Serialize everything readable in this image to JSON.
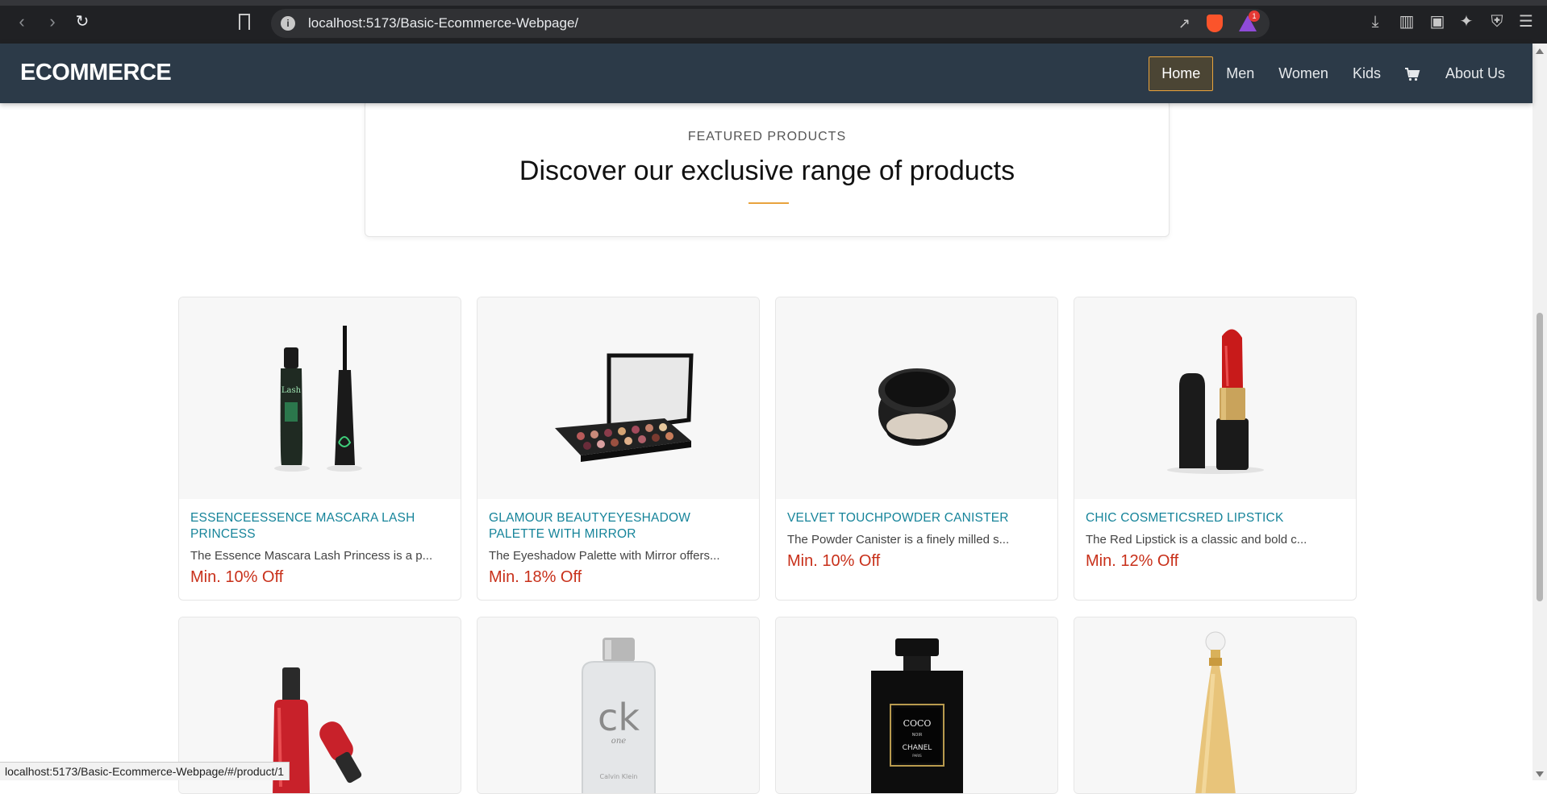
{
  "browser": {
    "url": "localhost:5173/Basic-Ecommerce-Webpage/",
    "notification_count": "1",
    "status_url": "localhost:5173/Basic-Ecommerce-Webpage/#/product/1"
  },
  "site": {
    "logo": "ECOMMERCE",
    "nav": [
      "Home",
      "Men",
      "Women",
      "Kids",
      "About Us"
    ],
    "active_nav": "Home"
  },
  "featured": {
    "eyebrow": "FEATURED PRODUCTS",
    "heading": "Discover our exclusive range of products"
  },
  "products": [
    {
      "title": "ESSENCEESSENCE MASCARA LASH PRINCESS",
      "description": "The Essence Mascara Lash Princess is a p...",
      "offer": "Min. 10% Off",
      "image_icon": "mascara-icon"
    },
    {
      "title": "GLAMOUR BEAUTYEYESHADOW PALETTE WITH MIRROR",
      "description": "The Eyeshadow Palette with Mirror offers...",
      "offer": "Min. 18% Off",
      "image_icon": "eyeshadow-palette-icon"
    },
    {
      "title": "VELVET TOUCHPOWDER CANISTER",
      "description": "The Powder Canister is a finely milled s...",
      "offer": "Min. 10% Off",
      "image_icon": "powder-canister-icon"
    },
    {
      "title": "CHIC COSMETICSRED LIPSTICK",
      "description": "The Red Lipstick is a classic and bold c...",
      "offer": "Min. 12% Off",
      "image_icon": "lipstick-icon"
    }
  ],
  "products_row2": [
    {
      "image_icon": "nail-polish-icon"
    },
    {
      "image_icon": "ck-one-perfume-icon",
      "label": "ck",
      "sub": "one",
      "brand": "Calvin Klein"
    },
    {
      "image_icon": "coco-noir-perfume-icon",
      "label": "COCO",
      "sub": "NOIR",
      "brand": "CHANEL",
      "city": "PARIS"
    },
    {
      "image_icon": "dior-perfume-icon"
    }
  ],
  "colors": {
    "header_bg": "#2c3a48",
    "accent": "#e8a33d",
    "title": "#16849a",
    "offer": "#c8301a"
  }
}
